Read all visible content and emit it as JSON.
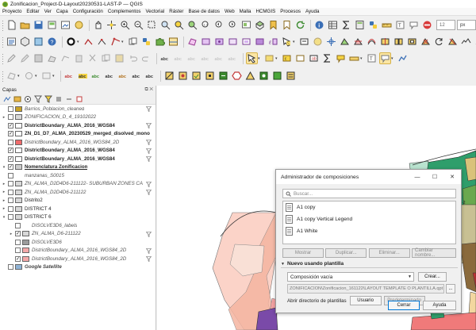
{
  "window": {
    "title": "Zonificacion_Project-D-Layout20230531-LAST-P — QGIS"
  },
  "menu": [
    "Proyecto",
    "Editar",
    "Ver",
    "Capa",
    "Configuración",
    "Complementos",
    "Vectorial",
    "Ráster",
    "Base de datos",
    "Web",
    "Malla",
    "HCMGIS",
    "Procesos",
    "Ayuda"
  ],
  "toolbar": {
    "spin_value": "12",
    "unit": "px"
  },
  "layers_panel": {
    "title": "Capas",
    "items": [
      {
        "label": "Barrios_Poblacion_cleaned",
        "checked": false,
        "style": "i",
        "symbol": "#c9a227",
        "filter": true,
        "indent": 0
      },
      {
        "label": "ZONIFICACION_D_4_19102022",
        "checked": false,
        "style": "i",
        "symbol": "#d8d8d8",
        "filter": false,
        "indent": 0,
        "expander": "▸"
      },
      {
        "label": "DistrictBoundary_ALMA_2016_WGS84",
        "checked": true,
        "style": "b",
        "symbol": "#ffffff",
        "filter": true,
        "indent": 0
      },
      {
        "label": "ZN_D1_D7_ALMA_20230529_merged_disolved_mono",
        "checked": true,
        "style": "b",
        "symbol": "#ffffff",
        "filter": false,
        "indent": 0
      },
      {
        "label": "DistrictBoundary_ALMA_2016_WGS84_2D",
        "checked": false,
        "style": "i",
        "symbol": "#f06b6b",
        "filter": true,
        "indent": 0
      },
      {
        "label": "DistrictBoundary_ALMA_2016_WGS84",
        "checked": true,
        "style": "b",
        "symbol": "#ffffff",
        "filter": true,
        "indent": 0
      },
      {
        "label": "DistrictBoundary_ALMA_2016_WGS84",
        "checked": true,
        "style": "b",
        "symbol": "#ffffff",
        "filter": true,
        "indent": 0
      },
      {
        "label": "Nomenclatura Zonificacion",
        "checked": true,
        "style": "bu",
        "symbol": "#cccccc",
        "filter": false,
        "indent": 0,
        "expander": "▾"
      },
      {
        "label": "manzanas_S0015",
        "checked": false,
        "style": "i",
        "symbol": "",
        "filter": false,
        "indent": 0
      },
      {
        "label": "ZN_ALMA_D2D4D6-211122- SUBURBAN ZONES CA",
        "checked": false,
        "style": "i",
        "symbol": "#d8d8d8",
        "filter": true,
        "indent": 0,
        "expander": "▸"
      },
      {
        "label": "ZN_ALMA_D2D4D6-211122",
        "checked": false,
        "style": "i",
        "symbol": "#d8d8d8",
        "filter": true,
        "indent": 0,
        "expander": "▸"
      },
      {
        "label": "Distrito2",
        "checked": false,
        "style": "",
        "symbol": "#d8d8d8",
        "filter": false,
        "indent": 0,
        "expander": "▸"
      },
      {
        "label": "DISTRICT 4",
        "checked": false,
        "style": "",
        "symbol": "#d8d8d8",
        "filter": false,
        "indent": 0,
        "expander": "▸"
      },
      {
        "label": "DISTRICT 6",
        "checked": false,
        "style": "",
        "symbol": "#d8d8d8",
        "filter": false,
        "indent": 0,
        "expander": "▾"
      },
      {
        "label": "DISOLVE3D6_labels",
        "checked": false,
        "style": "i",
        "symbol": "",
        "filter": false,
        "indent": 1
      },
      {
        "label": "ZN_ALMA_D6-211122",
        "checked": true,
        "style": "i",
        "symbol": "#d8d8d8",
        "filter": true,
        "indent": 1,
        "expander": "▸"
      },
      {
        "label": "DISOLVE3D6",
        "checked": false,
        "style": "i",
        "symbol": "#9c9c9c",
        "filter": false,
        "indent": 1
      },
      {
        "label": "DistrictBoundary_ALMA_2016_WGS84_2D",
        "checked": false,
        "style": "i",
        "symbol": "#f4a8a8",
        "filter": true,
        "indent": 1
      },
      {
        "label": "DistrictBoundary_ALMA_2016_WGS84_2D",
        "checked": true,
        "style": "i",
        "symbol": "#f4a8a8",
        "filter": true,
        "indent": 1
      },
      {
        "label": "Google Satellite",
        "checked": false,
        "style": "bi",
        "symbol": "#8fb3d6",
        "filter": false,
        "indent": 0
      }
    ]
  },
  "dialog": {
    "title": "Administrador de composiciones",
    "search_placeholder": "Buscar...",
    "templates": [
      "A1 copy",
      "A1 copy Vertical Legend",
      "A1 White"
    ],
    "buttons": {
      "show": "Mostrar",
      "duplicate": "Duplicar...",
      "remove": "Eliminar...",
      "rename": "Cambiar nombre..."
    },
    "section_title": "Nuevo usando plantilla",
    "combo_value": "Composición vacía",
    "create": "Crear...",
    "path": "ZONIFICACION\\Zonificacion_161122\\LAYOUT TEMPLATE O PLANTILLA.qpt",
    "browse": "...",
    "open_dir_label": "Abrir directorio de plantillas",
    "user": "Usuario",
    "default": "Predeterminado",
    "close": "Cerrar",
    "help": "Ayuda"
  },
  "map_label": "V-2"
}
